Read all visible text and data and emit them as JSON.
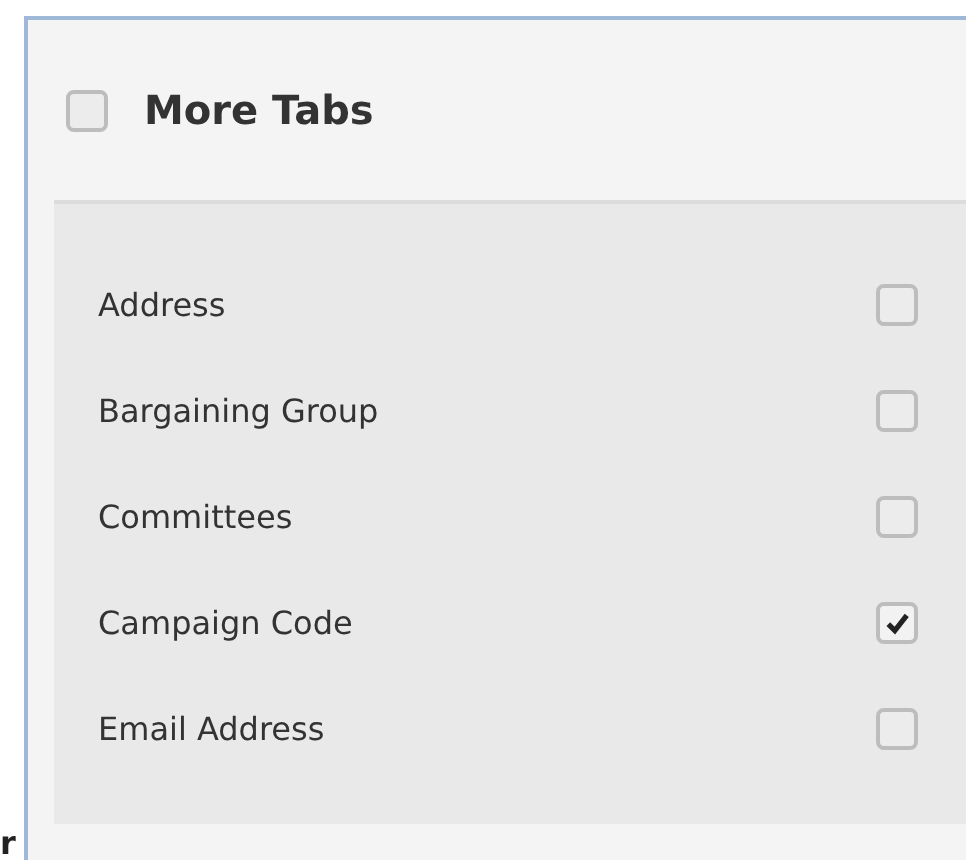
{
  "panel": {
    "title": "More Tabs",
    "checked": false
  },
  "options": [
    {
      "label": "Address",
      "checked": false
    },
    {
      "label": "Bargaining Group",
      "checked": false
    },
    {
      "label": "Committees",
      "checked": false
    },
    {
      "label": "Campaign Code",
      "checked": true
    },
    {
      "label": "Email Address",
      "checked": false
    }
  ],
  "side_text": "r"
}
